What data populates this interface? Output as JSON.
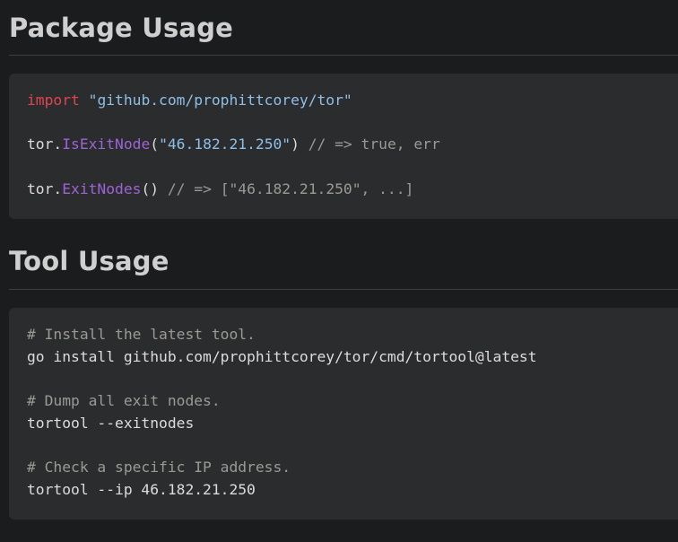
{
  "sections": [
    {
      "heading": "Package Usage",
      "code": [
        [
          {
            "t": "import",
            "k": "keyword"
          },
          {
            "t": " ",
            "k": "plain"
          },
          {
            "t": "\"github.com/prophittcorey/tor\"",
            "k": "string"
          }
        ],
        [
          {
            "t": "",
            "k": "plain"
          }
        ],
        [
          {
            "t": "tor.",
            "k": "plain"
          },
          {
            "t": "IsExitNode",
            "k": "func"
          },
          {
            "t": "(",
            "k": "plain"
          },
          {
            "t": "\"46.182.21.250\"",
            "k": "string"
          },
          {
            "t": ") ",
            "k": "plain"
          },
          {
            "t": "// => true, err",
            "k": "comment"
          }
        ],
        [
          {
            "t": "",
            "k": "plain"
          }
        ],
        [
          {
            "t": "tor.",
            "k": "plain"
          },
          {
            "t": "ExitNodes",
            "k": "func"
          },
          {
            "t": "() ",
            "k": "plain"
          },
          {
            "t": "// => [\"46.182.21.250\", ...]",
            "k": "comment"
          }
        ]
      ]
    },
    {
      "heading": "Tool Usage",
      "code": [
        [
          {
            "t": "# Install the latest tool.",
            "k": "comment"
          }
        ],
        [
          {
            "t": "go install github.com/prophittcorey/tor/cmd/tortool@latest",
            "k": "plain"
          }
        ],
        [
          {
            "t": "",
            "k": "plain"
          }
        ],
        [
          {
            "t": "# Dump all exit nodes.",
            "k": "comment"
          }
        ],
        [
          {
            "t": "tortool --exitnodes",
            "k": "plain"
          }
        ],
        [
          {
            "t": "",
            "k": "plain"
          }
        ],
        [
          {
            "t": "# Check a specific IP address.",
            "k": "comment"
          }
        ],
        [
          {
            "t": "tortool --ip 46.182.21.250",
            "k": "plain"
          }
        ]
      ]
    }
  ],
  "colors": {
    "background": "#1b1c1e",
    "code_background": "#2b2c2e",
    "heading": "#cfcfcf",
    "keyword": "#e0444f",
    "string": "#8ebfe6",
    "function": "#9e63d6",
    "comment": "#9a9a94",
    "plain": "#dcdcdc"
  }
}
